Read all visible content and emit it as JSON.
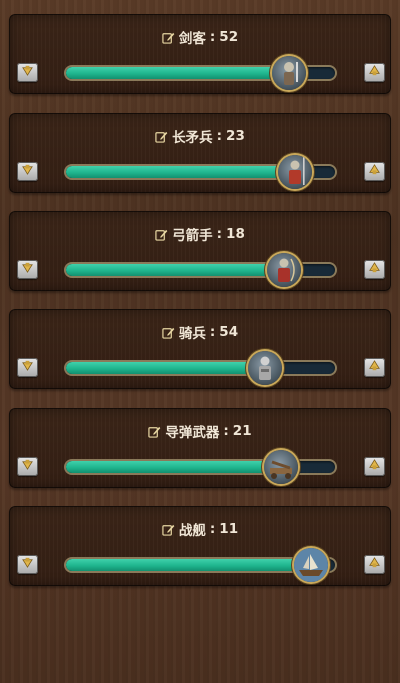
{
  "units": [
    {
      "name": "剑客",
      "count": "52",
      "fill": 0.83,
      "unit_icon": "swordsman-icon"
    },
    {
      "name": "长矛兵",
      "count": "23",
      "fill": 0.85,
      "unit_icon": "spearman-icon"
    },
    {
      "name": "弓箭手",
      "count": "18",
      "fill": 0.81,
      "unit_icon": "archer-icon"
    },
    {
      "name": "骑兵",
      "count": "54",
      "fill": 0.74,
      "unit_icon": "cavalry-icon"
    },
    {
      "name": "导弹武器",
      "count": "21",
      "fill": 0.8,
      "unit_icon": "siege-weapon-icon"
    },
    {
      "name": "战舰",
      "count": "11",
      "fill": 0.91,
      "unit_icon": "warship-icon"
    }
  ],
  "colors": {
    "fill": "#1fb58e",
    "track": "#182a38",
    "title": "#f0e6d6"
  }
}
